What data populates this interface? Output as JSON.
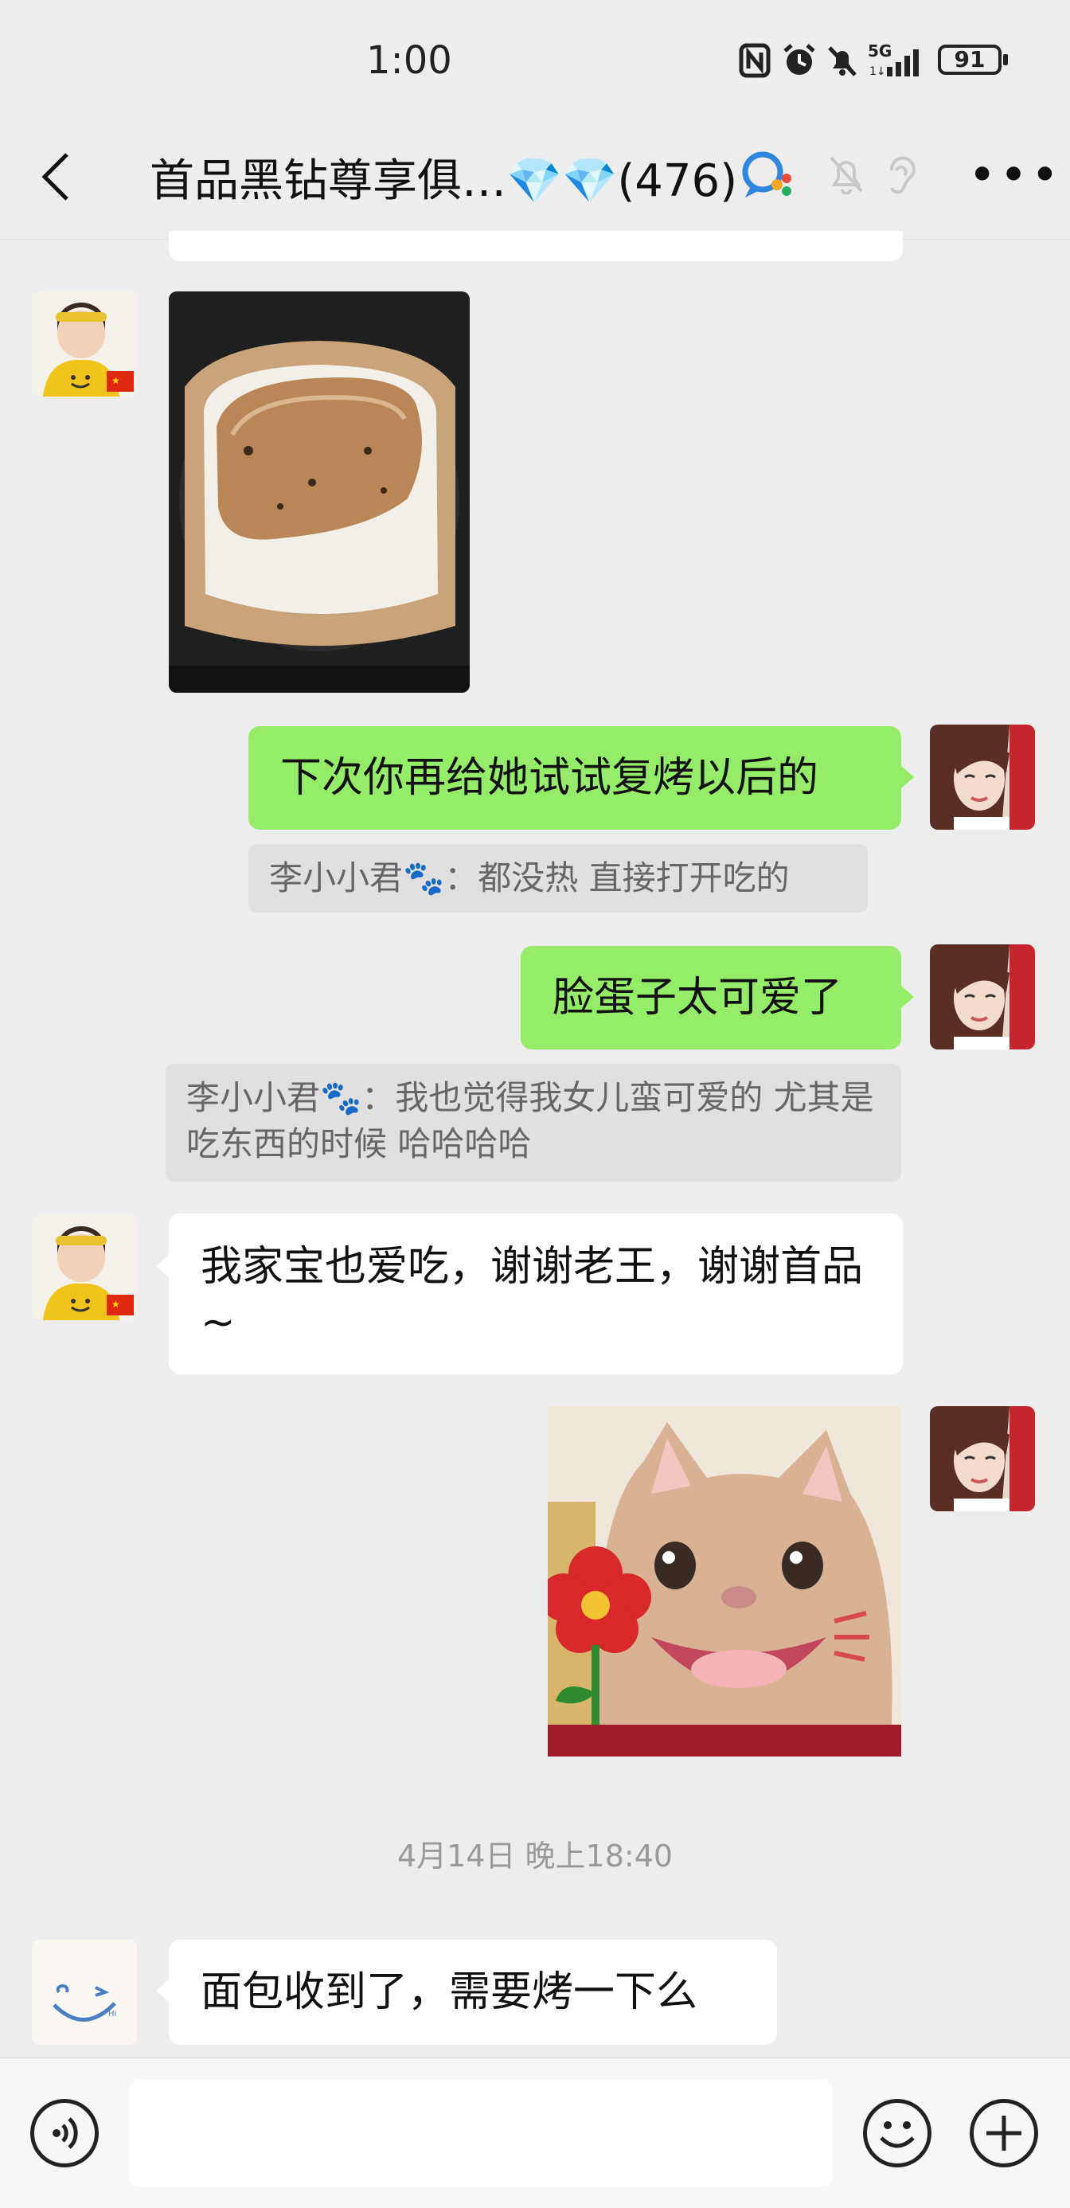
{
  "status_bar": {
    "time": "1:00",
    "network": "5G",
    "battery": "91",
    "icons": [
      "nfc-icon",
      "alarm-icon",
      "mute-icon",
      "signal-icon",
      "battery-icon"
    ]
  },
  "header": {
    "title": "首品黑钻尊享俱…💎💎(476)",
    "icons": [
      "back-icon",
      "chat-search-icon",
      "mute-bell-icon",
      "ear-icon",
      "more-icon"
    ]
  },
  "messages": [
    {
      "sender": "other",
      "type": "image",
      "image": "bread-in-air-fryer"
    },
    {
      "sender": "me",
      "type": "text",
      "text": "下次你再给她试试复烤以后的"
    },
    {
      "sender": "me",
      "type": "quote",
      "text": "李小小君🐾：都没热 直接打开吃的"
    },
    {
      "sender": "me",
      "type": "text",
      "text": "脸蛋子太可爱了"
    },
    {
      "sender": "me",
      "type": "quote",
      "text": "李小小君🐾：我也觉得我女儿蛮可爱的 尤其是吃东西的时候 哈哈哈哈"
    },
    {
      "sender": "other",
      "type": "text",
      "text": "我家宝也爱吃，谢谢老王，谢谢首品~"
    },
    {
      "sender": "me",
      "type": "image",
      "image": "cat-with-flower-sticker"
    },
    {
      "sender": "other2",
      "type": "text",
      "text": "面包收到了，需要烤一下么"
    }
  ],
  "timestamp": "4月14日 晚上18:40",
  "input_bar": {
    "placeholder": "",
    "icons": [
      "voice-icon",
      "emoji-icon",
      "plus-icon"
    ]
  },
  "colors": {
    "background": "#ededed",
    "my_bubble": "#95ec69",
    "other_bubble": "#ffffff",
    "quote": "#e0e0e0"
  }
}
